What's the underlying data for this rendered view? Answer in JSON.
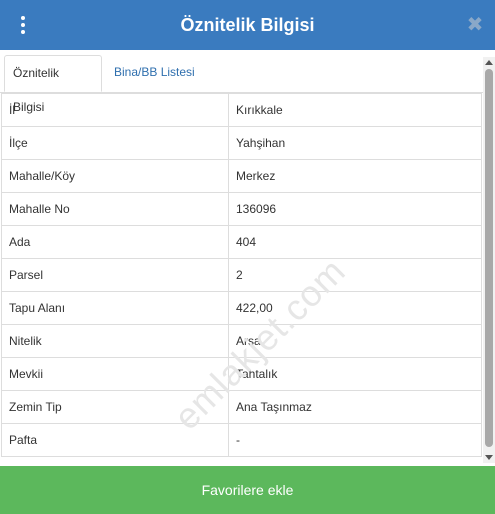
{
  "header": {
    "title": "Öznitelik Bilgisi",
    "menu_icon": "kebab-menu-icon",
    "close_icon": "close-icon",
    "close_glyph": "✖"
  },
  "tabs": [
    {
      "label": "Öznitelik Bilgisi",
      "active": true
    },
    {
      "label": "Bina/BB Listesi",
      "active": false
    }
  ],
  "attributes": [
    {
      "key": "İl",
      "value": "Kırıkkale"
    },
    {
      "key": "İlçe",
      "value": "Yahşihan"
    },
    {
      "key": "Mahalle/Köy",
      "value": "Merkez"
    },
    {
      "key": "Mahalle No",
      "value": "136096"
    },
    {
      "key": "Ada",
      "value": "404"
    },
    {
      "key": "Parsel",
      "value": "2"
    },
    {
      "key": "Tapu Alanı",
      "value": "422,00"
    },
    {
      "key": "Nitelik",
      "value": "Arsa"
    },
    {
      "key": "Mevkii",
      "value": "Tahtalık"
    },
    {
      "key": "Zemin Tip",
      "value": "Ana Taşınmaz"
    },
    {
      "key": "Pafta",
      "value": "-"
    }
  ],
  "watermark": "emlakjet.com",
  "footer": {
    "button_label": "Favorilere ekle"
  },
  "colors": {
    "header_bg": "#3a7bbf",
    "tab_link": "#2f6fae",
    "footer_bg": "#5cb85c"
  }
}
